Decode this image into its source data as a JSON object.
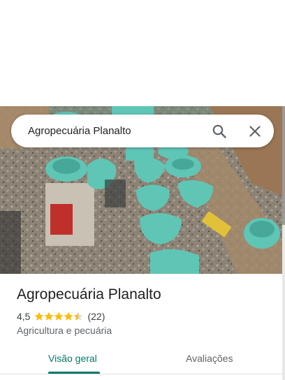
{
  "search": {
    "value": "Agropecuária Planalto",
    "search_icon": "search-icon",
    "close_icon": "close-icon"
  },
  "photo": {
    "subject": "place-photo"
  },
  "place": {
    "title": "Agropecuária Planalto",
    "rating": "4,5",
    "rating_value": 4.5,
    "review_count": "(22)",
    "category": "Agricultura e pecuária"
  },
  "tabs": [
    {
      "label": "Visão geral",
      "selected": true
    },
    {
      "label": "Avaliações",
      "selected": false
    }
  ],
  "colors": {
    "accent": "#00796b",
    "star": "#fbbc04",
    "star_empty": "#dadce0"
  }
}
